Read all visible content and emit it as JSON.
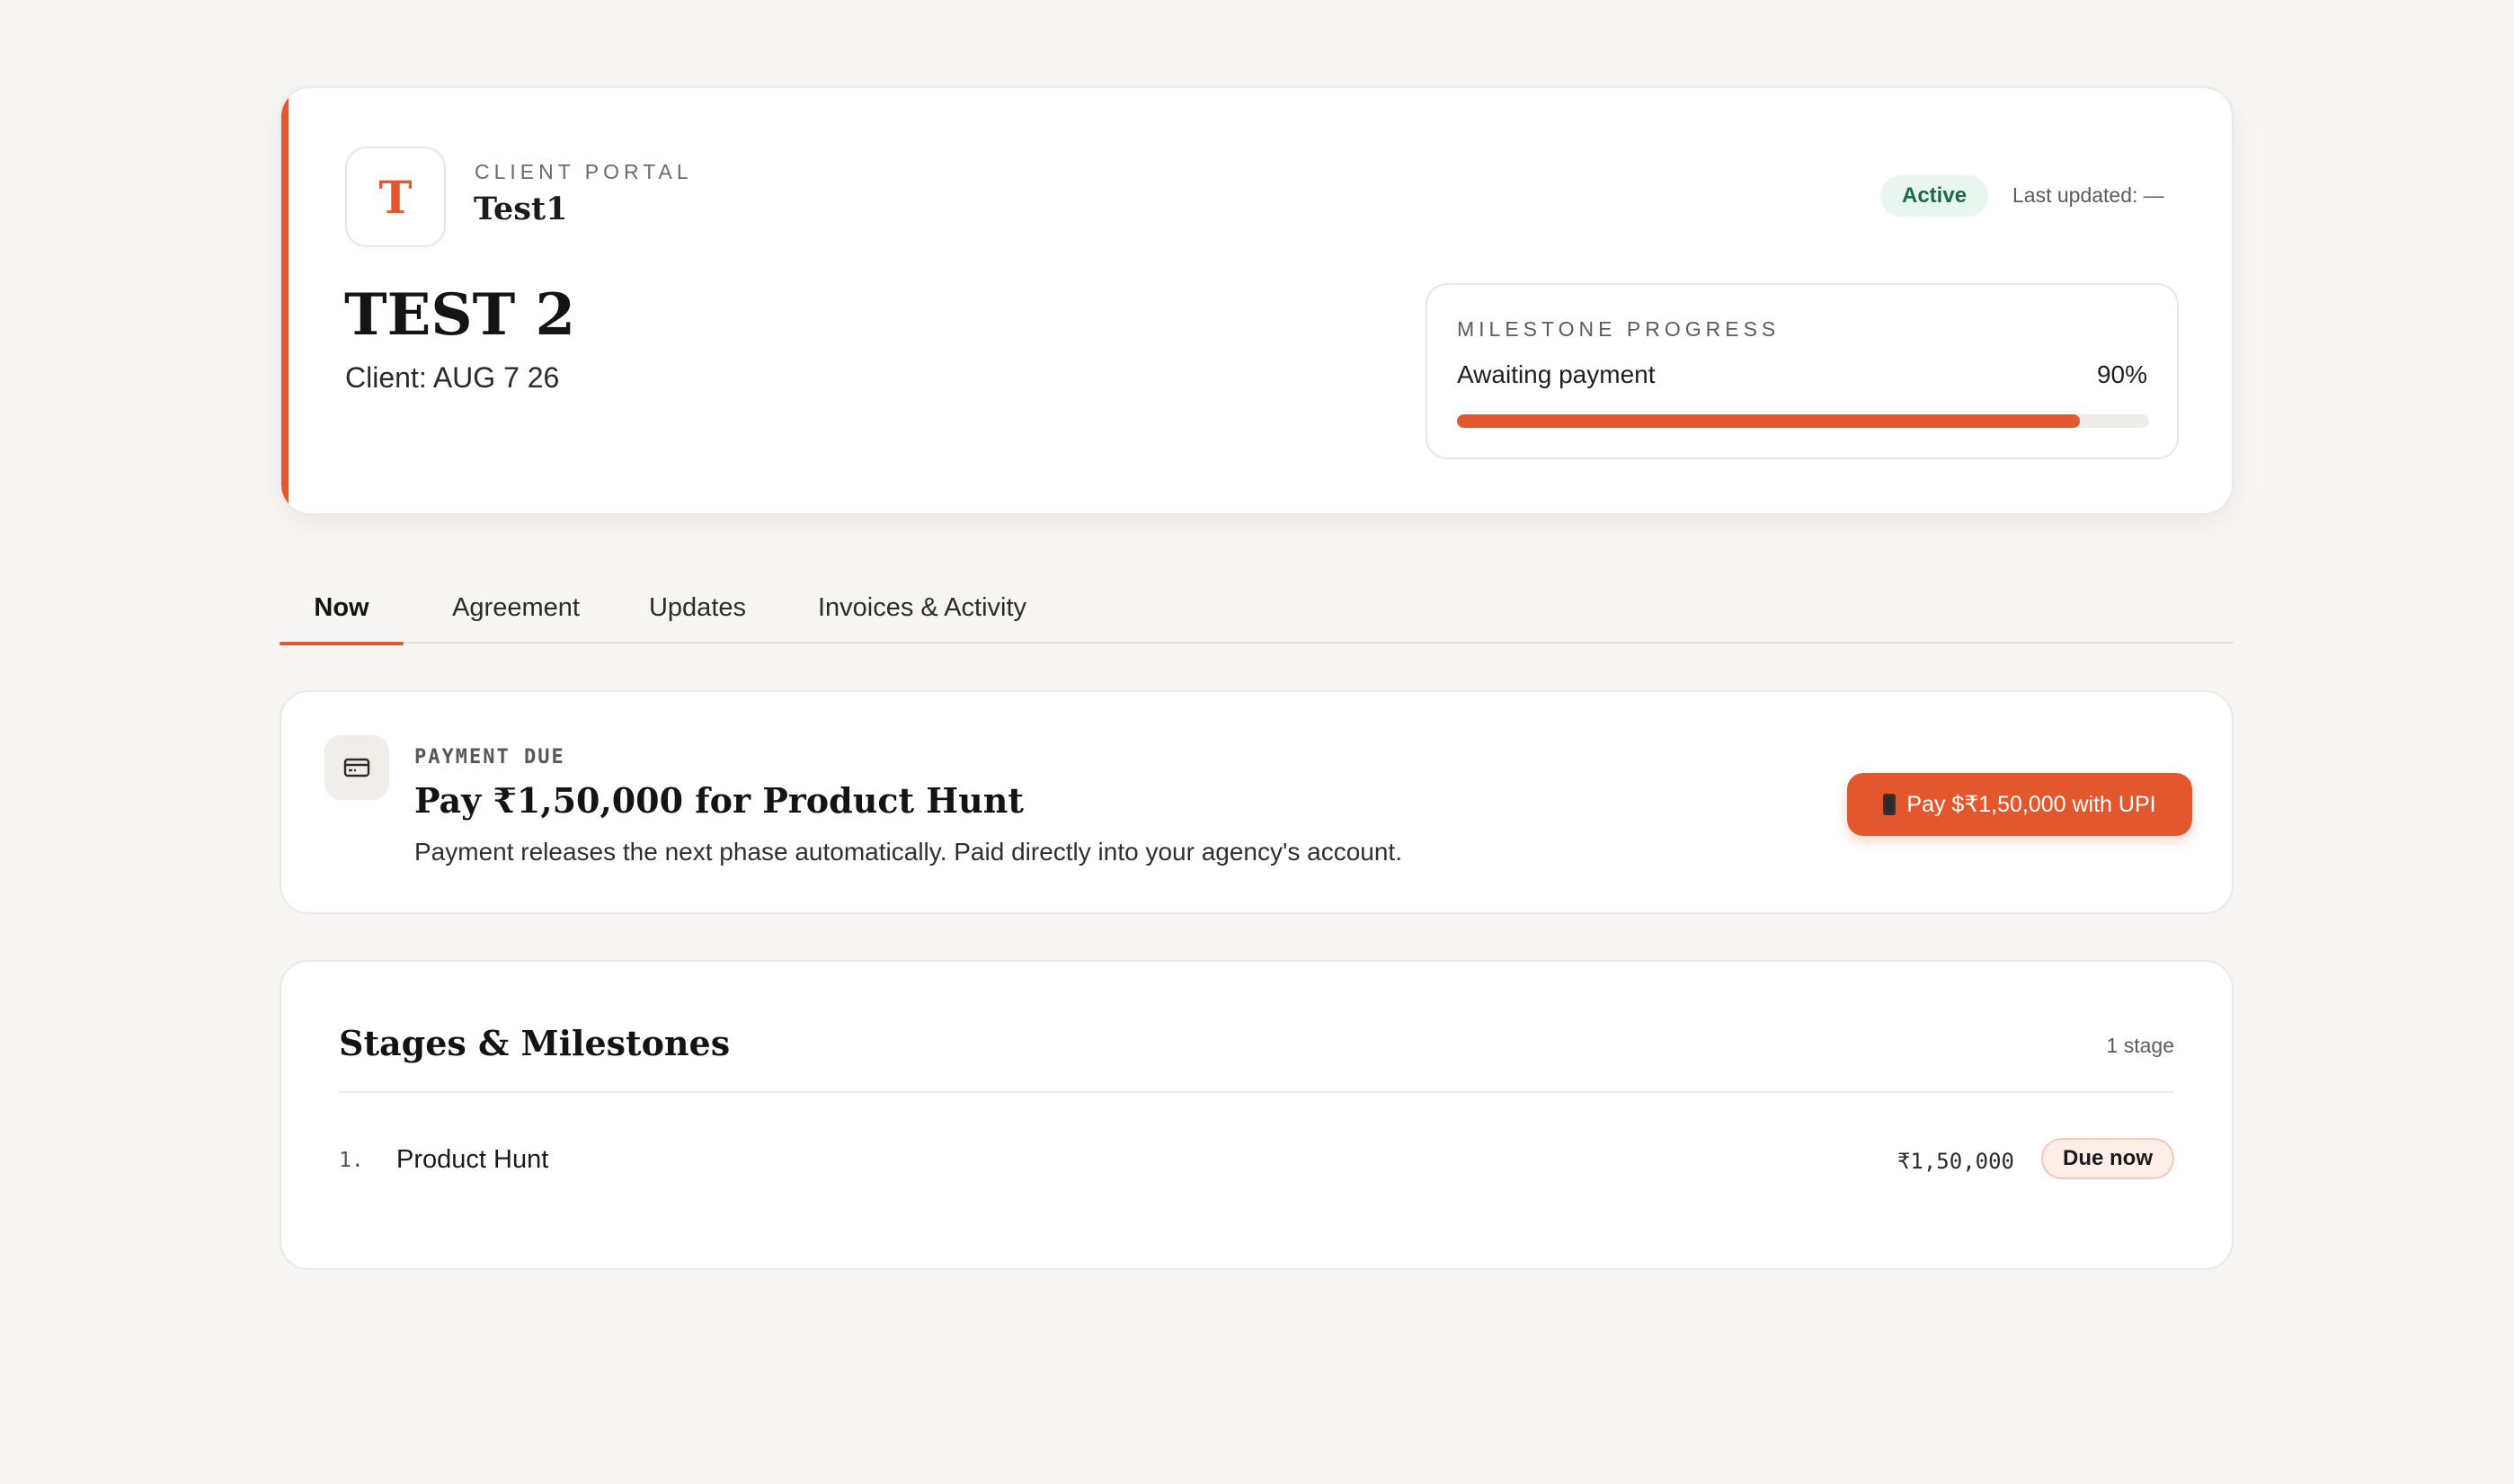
{
  "header": {
    "logo_letter": "T",
    "portal_label": "CLIENT PORTAL",
    "agency_name": "Test1",
    "project_title": "TEST 2",
    "client_line": "Client: AUG 7 26",
    "status": "Active",
    "last_updated": "Last updated: —",
    "progress": {
      "label": "MILESTONE PROGRESS",
      "status_text": "Awaiting payment",
      "percent_text": "90%",
      "percent_value": 90
    }
  },
  "tabs": [
    {
      "label": "Now",
      "active": true
    },
    {
      "label": "Agreement",
      "active": false
    },
    {
      "label": "Updates",
      "active": false
    },
    {
      "label": "Invoices & Activity",
      "active": false
    }
  ],
  "payment": {
    "icon": "credit-card-icon",
    "label": "PAYMENT DUE",
    "title": "Pay ₹1,50,000 for Product Hunt",
    "description": "Payment releases the next phase automatically. Paid directly into your agency's account.",
    "button_icon": "phone-icon",
    "button_label": "Pay $₹1,50,000 with UPI"
  },
  "stages": {
    "title": "Stages & Milestones",
    "count": "1 stage",
    "items": [
      {
        "number": "1.",
        "name": "Product Hunt",
        "amount": "₹1,50,000",
        "badge": "Due now"
      }
    ]
  },
  "colors": {
    "accent": "#e2572e",
    "background": "#f6f5f3",
    "active_badge_bg": "#e8f6ef",
    "active_badge_text": "#1d6b45",
    "due_badge_bg": "#fdeee8"
  }
}
